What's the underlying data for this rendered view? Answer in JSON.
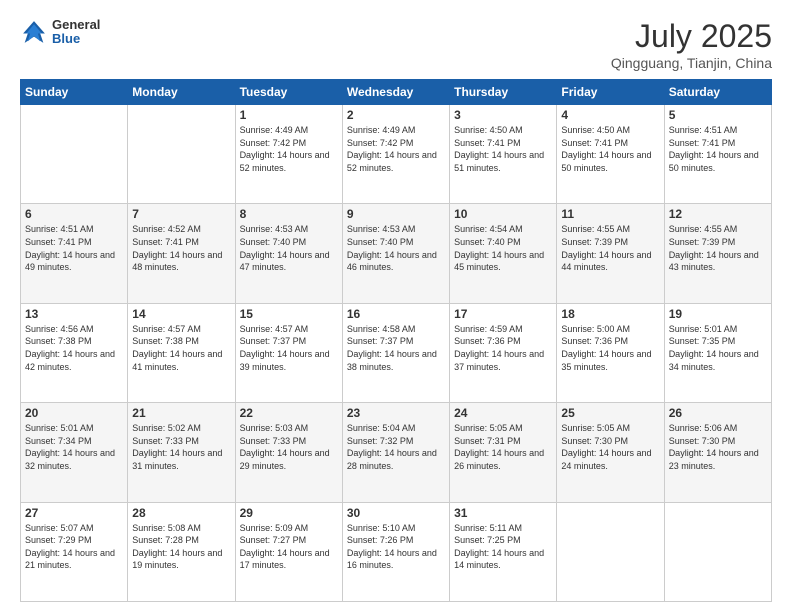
{
  "header": {
    "logo_general": "General",
    "logo_blue": "Blue",
    "month_title": "July 2025",
    "location": "Qingguang, Tianjin, China"
  },
  "weekdays": [
    "Sunday",
    "Monday",
    "Tuesday",
    "Wednesday",
    "Thursday",
    "Friday",
    "Saturday"
  ],
  "weeks": [
    [
      {
        "day": "",
        "sunrise": "",
        "sunset": "",
        "daylight": ""
      },
      {
        "day": "",
        "sunrise": "",
        "sunset": "",
        "daylight": ""
      },
      {
        "day": "1",
        "sunrise": "Sunrise: 4:49 AM",
        "sunset": "Sunset: 7:42 PM",
        "daylight": "Daylight: 14 hours and 52 minutes."
      },
      {
        "day": "2",
        "sunrise": "Sunrise: 4:49 AM",
        "sunset": "Sunset: 7:42 PM",
        "daylight": "Daylight: 14 hours and 52 minutes."
      },
      {
        "day": "3",
        "sunrise": "Sunrise: 4:50 AM",
        "sunset": "Sunset: 7:41 PM",
        "daylight": "Daylight: 14 hours and 51 minutes."
      },
      {
        "day": "4",
        "sunrise": "Sunrise: 4:50 AM",
        "sunset": "Sunset: 7:41 PM",
        "daylight": "Daylight: 14 hours and 50 minutes."
      },
      {
        "day": "5",
        "sunrise": "Sunrise: 4:51 AM",
        "sunset": "Sunset: 7:41 PM",
        "daylight": "Daylight: 14 hours and 50 minutes."
      }
    ],
    [
      {
        "day": "6",
        "sunrise": "Sunrise: 4:51 AM",
        "sunset": "Sunset: 7:41 PM",
        "daylight": "Daylight: 14 hours and 49 minutes."
      },
      {
        "day": "7",
        "sunrise": "Sunrise: 4:52 AM",
        "sunset": "Sunset: 7:41 PM",
        "daylight": "Daylight: 14 hours and 48 minutes."
      },
      {
        "day": "8",
        "sunrise": "Sunrise: 4:53 AM",
        "sunset": "Sunset: 7:40 PM",
        "daylight": "Daylight: 14 hours and 47 minutes."
      },
      {
        "day": "9",
        "sunrise": "Sunrise: 4:53 AM",
        "sunset": "Sunset: 7:40 PM",
        "daylight": "Daylight: 14 hours and 46 minutes."
      },
      {
        "day": "10",
        "sunrise": "Sunrise: 4:54 AM",
        "sunset": "Sunset: 7:40 PM",
        "daylight": "Daylight: 14 hours and 45 minutes."
      },
      {
        "day": "11",
        "sunrise": "Sunrise: 4:55 AM",
        "sunset": "Sunset: 7:39 PM",
        "daylight": "Daylight: 14 hours and 44 minutes."
      },
      {
        "day": "12",
        "sunrise": "Sunrise: 4:55 AM",
        "sunset": "Sunset: 7:39 PM",
        "daylight": "Daylight: 14 hours and 43 minutes."
      }
    ],
    [
      {
        "day": "13",
        "sunrise": "Sunrise: 4:56 AM",
        "sunset": "Sunset: 7:38 PM",
        "daylight": "Daylight: 14 hours and 42 minutes."
      },
      {
        "day": "14",
        "sunrise": "Sunrise: 4:57 AM",
        "sunset": "Sunset: 7:38 PM",
        "daylight": "Daylight: 14 hours and 41 minutes."
      },
      {
        "day": "15",
        "sunrise": "Sunrise: 4:57 AM",
        "sunset": "Sunset: 7:37 PM",
        "daylight": "Daylight: 14 hours and 39 minutes."
      },
      {
        "day": "16",
        "sunrise": "Sunrise: 4:58 AM",
        "sunset": "Sunset: 7:37 PM",
        "daylight": "Daylight: 14 hours and 38 minutes."
      },
      {
        "day": "17",
        "sunrise": "Sunrise: 4:59 AM",
        "sunset": "Sunset: 7:36 PM",
        "daylight": "Daylight: 14 hours and 37 minutes."
      },
      {
        "day": "18",
        "sunrise": "Sunrise: 5:00 AM",
        "sunset": "Sunset: 7:36 PM",
        "daylight": "Daylight: 14 hours and 35 minutes."
      },
      {
        "day": "19",
        "sunrise": "Sunrise: 5:01 AM",
        "sunset": "Sunset: 7:35 PM",
        "daylight": "Daylight: 14 hours and 34 minutes."
      }
    ],
    [
      {
        "day": "20",
        "sunrise": "Sunrise: 5:01 AM",
        "sunset": "Sunset: 7:34 PM",
        "daylight": "Daylight: 14 hours and 32 minutes."
      },
      {
        "day": "21",
        "sunrise": "Sunrise: 5:02 AM",
        "sunset": "Sunset: 7:33 PM",
        "daylight": "Daylight: 14 hours and 31 minutes."
      },
      {
        "day": "22",
        "sunrise": "Sunrise: 5:03 AM",
        "sunset": "Sunset: 7:33 PM",
        "daylight": "Daylight: 14 hours and 29 minutes."
      },
      {
        "day": "23",
        "sunrise": "Sunrise: 5:04 AM",
        "sunset": "Sunset: 7:32 PM",
        "daylight": "Daylight: 14 hours and 28 minutes."
      },
      {
        "day": "24",
        "sunrise": "Sunrise: 5:05 AM",
        "sunset": "Sunset: 7:31 PM",
        "daylight": "Daylight: 14 hours and 26 minutes."
      },
      {
        "day": "25",
        "sunrise": "Sunrise: 5:05 AM",
        "sunset": "Sunset: 7:30 PM",
        "daylight": "Daylight: 14 hours and 24 minutes."
      },
      {
        "day": "26",
        "sunrise": "Sunrise: 5:06 AM",
        "sunset": "Sunset: 7:30 PM",
        "daylight": "Daylight: 14 hours and 23 minutes."
      }
    ],
    [
      {
        "day": "27",
        "sunrise": "Sunrise: 5:07 AM",
        "sunset": "Sunset: 7:29 PM",
        "daylight": "Daylight: 14 hours and 21 minutes."
      },
      {
        "day": "28",
        "sunrise": "Sunrise: 5:08 AM",
        "sunset": "Sunset: 7:28 PM",
        "daylight": "Daylight: 14 hours and 19 minutes."
      },
      {
        "day": "29",
        "sunrise": "Sunrise: 5:09 AM",
        "sunset": "Sunset: 7:27 PM",
        "daylight": "Daylight: 14 hours and 17 minutes."
      },
      {
        "day": "30",
        "sunrise": "Sunrise: 5:10 AM",
        "sunset": "Sunset: 7:26 PM",
        "daylight": "Daylight: 14 hours and 16 minutes."
      },
      {
        "day": "31",
        "sunrise": "Sunrise: 5:11 AM",
        "sunset": "Sunset: 7:25 PM",
        "daylight": "Daylight: 14 hours and 14 minutes."
      },
      {
        "day": "",
        "sunrise": "",
        "sunset": "",
        "daylight": ""
      },
      {
        "day": "",
        "sunrise": "",
        "sunset": "",
        "daylight": ""
      }
    ]
  ]
}
